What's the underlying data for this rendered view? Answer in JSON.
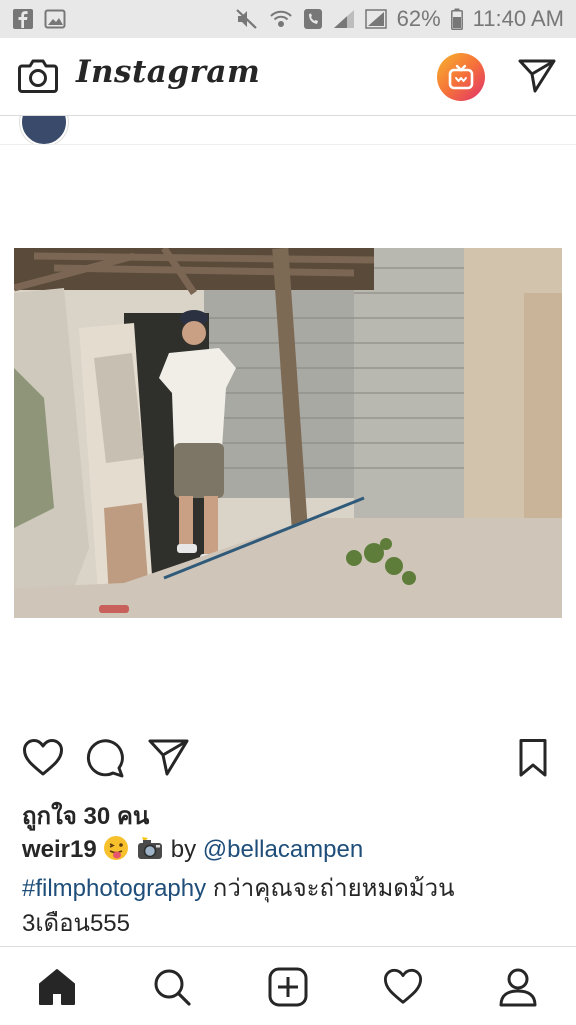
{
  "status_bar": {
    "battery": "62%",
    "time": "11:40 AM",
    "icons": [
      "facebook-icon",
      "image-icon",
      "mute-icon",
      "wifi-call-icon",
      "phone-icon",
      "signal-icon",
      "signal-icon",
      "battery-icon"
    ]
  },
  "header": {
    "logo": "Instagram",
    "icons": [
      "camera-icon",
      "igtv-icon",
      "direct-message-icon"
    ]
  },
  "post": {
    "actions": [
      "heart-icon",
      "comment-icon",
      "share-icon",
      "bookmark-icon"
    ],
    "likes": "ถูกใจ 30 คน",
    "caption": {
      "username": "weir19",
      "by": "by",
      "mention": "@bellacampen",
      "hashtag": "#filmphotography",
      "text_line1": "กว่าคุณจะถ่ายหมดม้วน",
      "text_line2": "3เดือน555"
    }
  },
  "bottom_nav": {
    "items": [
      "home-icon",
      "search-icon",
      "add-post-icon",
      "activity-heart-icon",
      "profile-icon"
    ]
  },
  "colors": {
    "status_bar_bg": "#e8e8e8",
    "text": "#262626",
    "link": "#1e4e79",
    "divider": "#dbdbdb"
  }
}
